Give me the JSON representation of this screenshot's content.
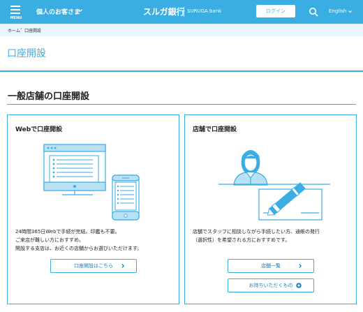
{
  "header": {
    "menu_label": "MENU",
    "customer_type": "個人のお客さま",
    "logo_jp": "スルガ銀行",
    "logo_en": "SURUGA bank",
    "login_label": "ログイン",
    "language": "English"
  },
  "breadcrumb": {
    "home": "ホーム",
    "separator": "›",
    "current": "口座開設"
  },
  "page_title": "口座開設",
  "section_title": "一般店舗の口座開設",
  "cards": [
    {
      "title": "Webで口座開設",
      "desc_lines": [
        "24時間365日Webで手続が完結。印鑑も不要。",
        "ご来店が難しい方におすすめ。",
        "開設する支店は、お近くの店舗からお選びいただけます。"
      ],
      "button_label": "口座開設はこちら",
      "button_icon": "chevron-right-icon"
    },
    {
      "title": "店舗で口座開設",
      "desc_lines": [
        "店舗でスタッフに相談しながら手続したい方、通帳の発行",
        "（選択性）を希望される方におすすめです。"
      ],
      "button1_label": "店舗一覧",
      "button1_icon": "chevron-right-icon",
      "button2_label": "お持ちいただくもの",
      "button2_icon": "plus-circle-icon"
    }
  ],
  "colors": {
    "brand": "#3aaee3",
    "breadcrumb_bg": "#e8f5fc",
    "link_text": "#1a7bb0",
    "illustration_fill": "#b8e1f5"
  }
}
